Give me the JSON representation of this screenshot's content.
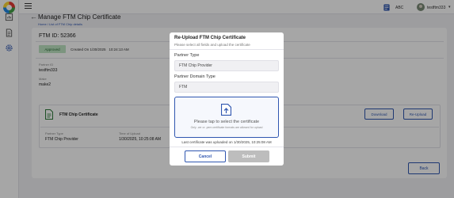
{
  "topbar": {
    "language": "ABC",
    "user_name": "testftm333"
  },
  "page": {
    "title": "Manage FTM Chip Certificate",
    "breadcrumb": "Home / List of FTM Chip details"
  },
  "details": {
    "ftm_id_label": "FTM ID:",
    "ftm_id_value": "52366",
    "status": "Approved",
    "created_label": "Created On",
    "created_value": "1/30/2025",
    "created_time": "10:24:13 AM",
    "partner_id_label": "Partner ID",
    "partner_id_value": "testftm333",
    "make_label": "Make",
    "make_value": "make2"
  },
  "chip_panel": {
    "title": "FTM Chip Certificate",
    "partner_type_label": "Partner Type",
    "partner_type_value": "FTM Chip Provider",
    "time_label": "Time of Upload",
    "time_value": "1/30/2025, 10:25:08 AM",
    "download_label": "Download",
    "reupload_label": "Re-Upload"
  },
  "back_label": "Back",
  "modal": {
    "title": "Re-Upload FTM Chip Certificate",
    "subtitle": "Please select all fields and upload the certificate",
    "partner_type_label": "Partner Type",
    "partner_type_value": "FTM Chip Provider",
    "domain_label": "Partner Domain Type",
    "domain_value": "FTM",
    "dropzone_text": "Please tap to select the certificate",
    "dropzone_hint": "Only .cer or .pem certificate formats are allowed for upload",
    "last_upload": "Last certificate was uploaded on 1/30/2025, 10:25:08 AM",
    "cancel_label": "Cancel",
    "submit_label": "Submit"
  },
  "icons": {
    "logo": "app-logo",
    "hamburger": "menu-icon",
    "language": "translate-icon",
    "upload": "upload-icon",
    "document": "document-icon"
  },
  "colors": {
    "primary": "#2f56b0",
    "approved_bg": "#bfe5c4",
    "approved_text": "#2a6b35",
    "submit_disabled": "#bdbdbd"
  }
}
